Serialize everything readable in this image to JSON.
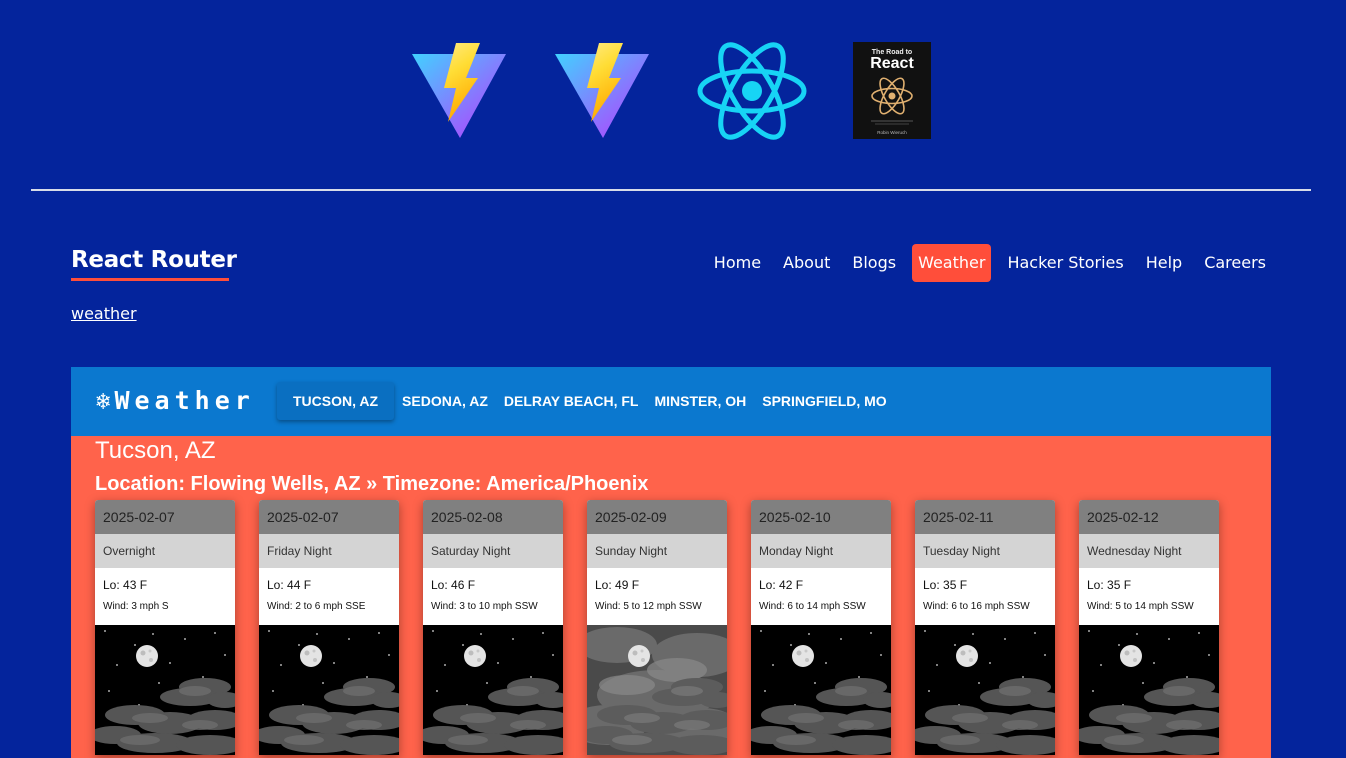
{
  "logos": [
    {
      "name": "vite-logo"
    },
    {
      "name": "vite-logo"
    },
    {
      "name": "react-logo"
    },
    {
      "name": "road-to-react-book",
      "title_small": "The Road to",
      "title_big": "React",
      "author": "Robin Wieruch"
    }
  ],
  "header": {
    "brand": "React Router",
    "nav": [
      {
        "label": "Home",
        "active": false
      },
      {
        "label": "About",
        "active": false
      },
      {
        "label": "Blogs",
        "active": false
      },
      {
        "label": "Weather",
        "active": true
      },
      {
        "label": "Hacker Stories",
        "active": false
      },
      {
        "label": "Help",
        "active": false
      },
      {
        "label": "Careers",
        "active": false
      }
    ]
  },
  "breadcrumb": "weather",
  "weather": {
    "title": "Weather",
    "icon": "snowflake-icon",
    "tabs": [
      {
        "label": "TUCSON, AZ",
        "active": true
      },
      {
        "label": "SEDONA, AZ",
        "active": false
      },
      {
        "label": "DELRAY BEACH, FL",
        "active": false
      },
      {
        "label": "MINSTER, OH",
        "active": false
      },
      {
        "label": "SPRINGFIELD, MO",
        "active": false
      }
    ],
    "city": "Tucson, AZ",
    "location_line": "Location: Flowing Wells, AZ » Timezone: America/Phoenix",
    "forecast": [
      {
        "date": "2025-02-07",
        "period": "Overnight",
        "lo": "Lo: 43 F",
        "wind": "Wind: 3 mph S",
        "image": "night-clear-moon"
      },
      {
        "date": "2025-02-07",
        "period": "Friday Night",
        "lo": "Lo: 44 F",
        "wind": "Wind: 2 to 6 mph SSE",
        "image": "night-clear-moon"
      },
      {
        "date": "2025-02-08",
        "period": "Saturday Night",
        "lo": "Lo: 46 F",
        "wind": "Wind: 3 to 10 mph SSW",
        "image": "night-clear-moon"
      },
      {
        "date": "2025-02-09",
        "period": "Sunday Night",
        "lo": "Lo: 49 F",
        "wind": "Wind: 5 to 12 mph SSW",
        "image": "night-cloudy-moon"
      },
      {
        "date": "2025-02-10",
        "period": "Monday Night",
        "lo": "Lo: 42 F",
        "wind": "Wind: 6 to 14 mph SSW",
        "image": "night-clear-moon"
      },
      {
        "date": "2025-02-11",
        "period": "Tuesday Night",
        "lo": "Lo: 35 F",
        "wind": "Wind: 6 to 16 mph SSW",
        "image": "night-clear-moon"
      },
      {
        "date": "2025-02-12",
        "period": "Wednesday Night",
        "lo": "Lo: 35 F",
        "wind": "Wind: 5 to 14 mph SSW",
        "image": "night-clear-moon"
      }
    ]
  },
  "colors": {
    "page_bg": "#04249c",
    "accent": "#ff4e3a",
    "appbar": "#0b78cf",
    "panel": "#ff634b"
  }
}
